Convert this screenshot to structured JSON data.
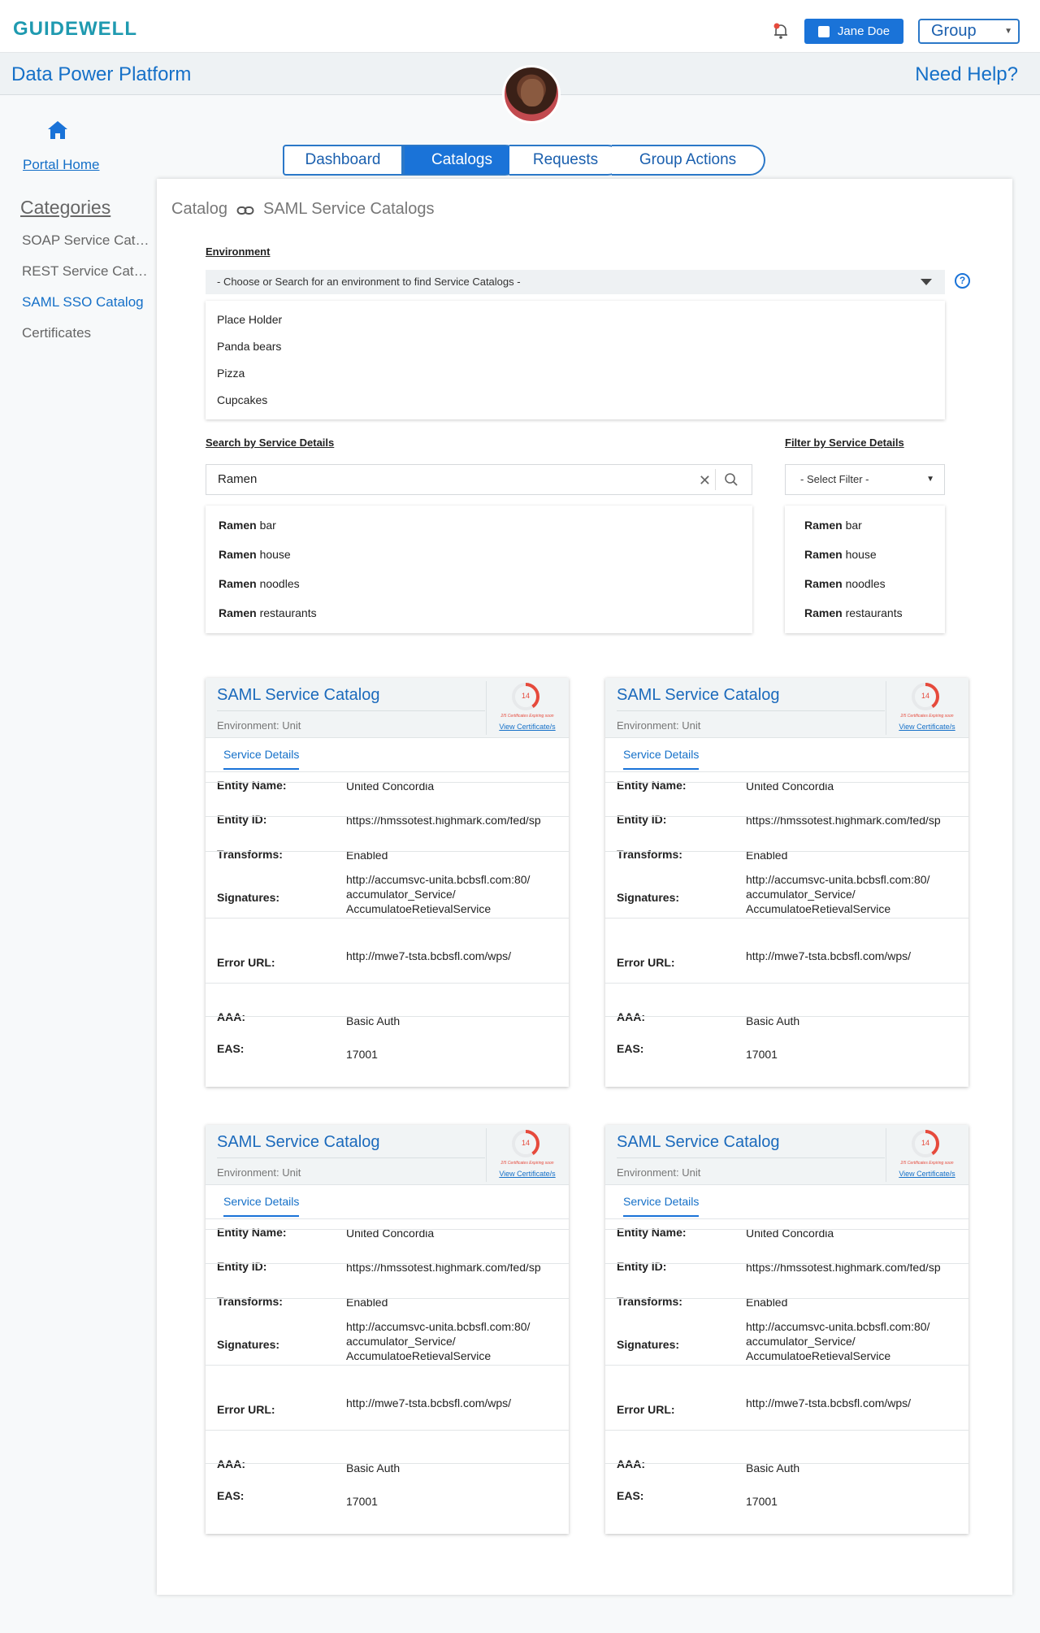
{
  "brand": {
    "logo": "GUIDEWELL"
  },
  "header": {
    "user": "Jane Doe",
    "group": "Group"
  },
  "titlebar": {
    "title": "Data Power Platform",
    "help": "Need Help?"
  },
  "sidebar": {
    "portal_home": "Portal Home",
    "categories_title": "Categories",
    "items": [
      {
        "label": "SOAP Service Catalog"
      },
      {
        "label": "REST Service Catalog"
      },
      {
        "label": "SAML SSO Catalog"
      },
      {
        "label": "Certificates"
      }
    ]
  },
  "tabs": [
    {
      "label": "Dashboard"
    },
    {
      "label": "Catalogs"
    },
    {
      "label": "Requests"
    },
    {
      "label": "Group Actions"
    }
  ],
  "breadcrumb": {
    "root": "Catalog",
    "current": "SAML Service Catalogs"
  },
  "environment": {
    "label": "Environment",
    "placeholder": "- Choose or Search for an environment to find Service Catalogs -",
    "options": [
      "Place Holder",
      "Panda bears",
      "Pizza",
      "Cupcakes"
    ]
  },
  "search": {
    "label": "Search by Service Details",
    "value": "Ramen",
    "suggestions": [
      {
        "bold": "Ramen",
        "rest": " bar"
      },
      {
        "bold": "Ramen",
        "rest": " house"
      },
      {
        "bold": "Ramen",
        "rest": " noodles"
      },
      {
        "bold": "Ramen",
        "rest": " restaurants"
      }
    ]
  },
  "filter": {
    "label": "Filter by Service Details",
    "placeholder": "- Select Filter -",
    "suggestions": [
      {
        "bold": "Ramen",
        "rest": " bar"
      },
      {
        "bold": "Ramen",
        "rest": " house"
      },
      {
        "bold": "Ramen",
        "rest": " noodles"
      },
      {
        "bold": "Ramen",
        "rest": " restaurants"
      }
    ]
  },
  "cards": [
    {
      "title": "SAML Service Catalog",
      "environment": "Environment: Unit",
      "cert_count": "14",
      "cert_expiring": "2/5 Certificates Expiring soon",
      "view_cert": "View Certificate/s",
      "tab": "Service Details",
      "rows": [
        {
          "label": "Entity Name:",
          "value": "United Concordia"
        },
        {
          "label": "Entity ID:",
          "value": "https://hmssotest.highmark.com/fed/sp"
        },
        {
          "label": "Transforms:",
          "value": "Enabled"
        },
        {
          "label": "Signatures:",
          "value": "http://accumsvc-unita.bcbsfl.com:80/ accumulator_Service/ AccumulatoeRetievalService"
        },
        {
          "label": "Error URL:",
          "value": "http://mwe7-tsta.bcbsfl.com/wps/"
        },
        {
          "label": "AAA:",
          "value": "Basic Auth"
        },
        {
          "label": "EAS:",
          "value": "17001"
        }
      ]
    },
    {
      "title": "SAML Service Catalog",
      "environment": "Environment: Unit",
      "cert_count": "14",
      "cert_expiring": "2/5 Certificates Expiring soon",
      "view_cert": "View Certificate/s",
      "tab": "Service Details",
      "rows": [
        {
          "label": "Entity Name:",
          "value": "United Concordia"
        },
        {
          "label": "Entity ID:",
          "value": "https://hmssotest.highmark.com/fed/sp"
        },
        {
          "label": "Transforms:",
          "value": "Enabled"
        },
        {
          "label": "Signatures:",
          "value": "http://accumsvc-unita.bcbsfl.com:80/ accumulator_Service/ AccumulatoeRetievalService"
        },
        {
          "label": "Error URL:",
          "value": "http://mwe7-tsta.bcbsfl.com/wps/"
        },
        {
          "label": "AAA:",
          "value": "Basic Auth"
        },
        {
          "label": "EAS:",
          "value": "17001"
        }
      ]
    },
    {
      "title": "SAML Service Catalog",
      "environment": "Environment: Unit",
      "cert_count": "14",
      "cert_expiring": "2/5 Certificates Expiring soon",
      "view_cert": "View Certificate/s",
      "tab": "Service Details",
      "rows": [
        {
          "label": "Entity Name:",
          "value": "United Concordia"
        },
        {
          "label": "Entity ID:",
          "value": "https://hmssotest.highmark.com/fed/sp"
        },
        {
          "label": "Transforms:",
          "value": "Enabled"
        },
        {
          "label": "Signatures:",
          "value": "http://accumsvc-unita.bcbsfl.com:80/ accumulator_Service/ AccumulatoeRetievalService"
        },
        {
          "label": "Error URL:",
          "value": "http://mwe7-tsta.bcbsfl.com/wps/"
        },
        {
          "label": "AAA:",
          "value": "Basic Auth"
        },
        {
          "label": "EAS:",
          "value": "17001"
        }
      ]
    },
    {
      "title": "SAML Service Catalog",
      "environment": "Environment: Unit",
      "cert_count": "14",
      "cert_expiring": "2/5 Certificates Expiring soon",
      "view_cert": "View Certificate/s",
      "tab": "Service Details",
      "rows": [
        {
          "label": "Entity Name:",
          "value": "United Concordia"
        },
        {
          "label": "Entity ID:",
          "value": "https://hmssotest.highmark.com/fed/sp"
        },
        {
          "label": "Transforms:",
          "value": "Enabled"
        },
        {
          "label": "Signatures:",
          "value": "http://accumsvc-unita.bcbsfl.com:80/ accumulator_Service/ AccumulatoeRetievalService"
        },
        {
          "label": "Error URL:",
          "value": "http://mwe7-tsta.bcbsfl.com/wps/"
        },
        {
          "label": "AAA:",
          "value": "Basic Auth"
        },
        {
          "label": "EAS:",
          "value": "17001"
        }
      ]
    }
  ],
  "colors": {
    "brand": "#1f9ab0",
    "primary": "#1a73d8",
    "link": "#1570c8",
    "alert": "#e64a3c"
  }
}
